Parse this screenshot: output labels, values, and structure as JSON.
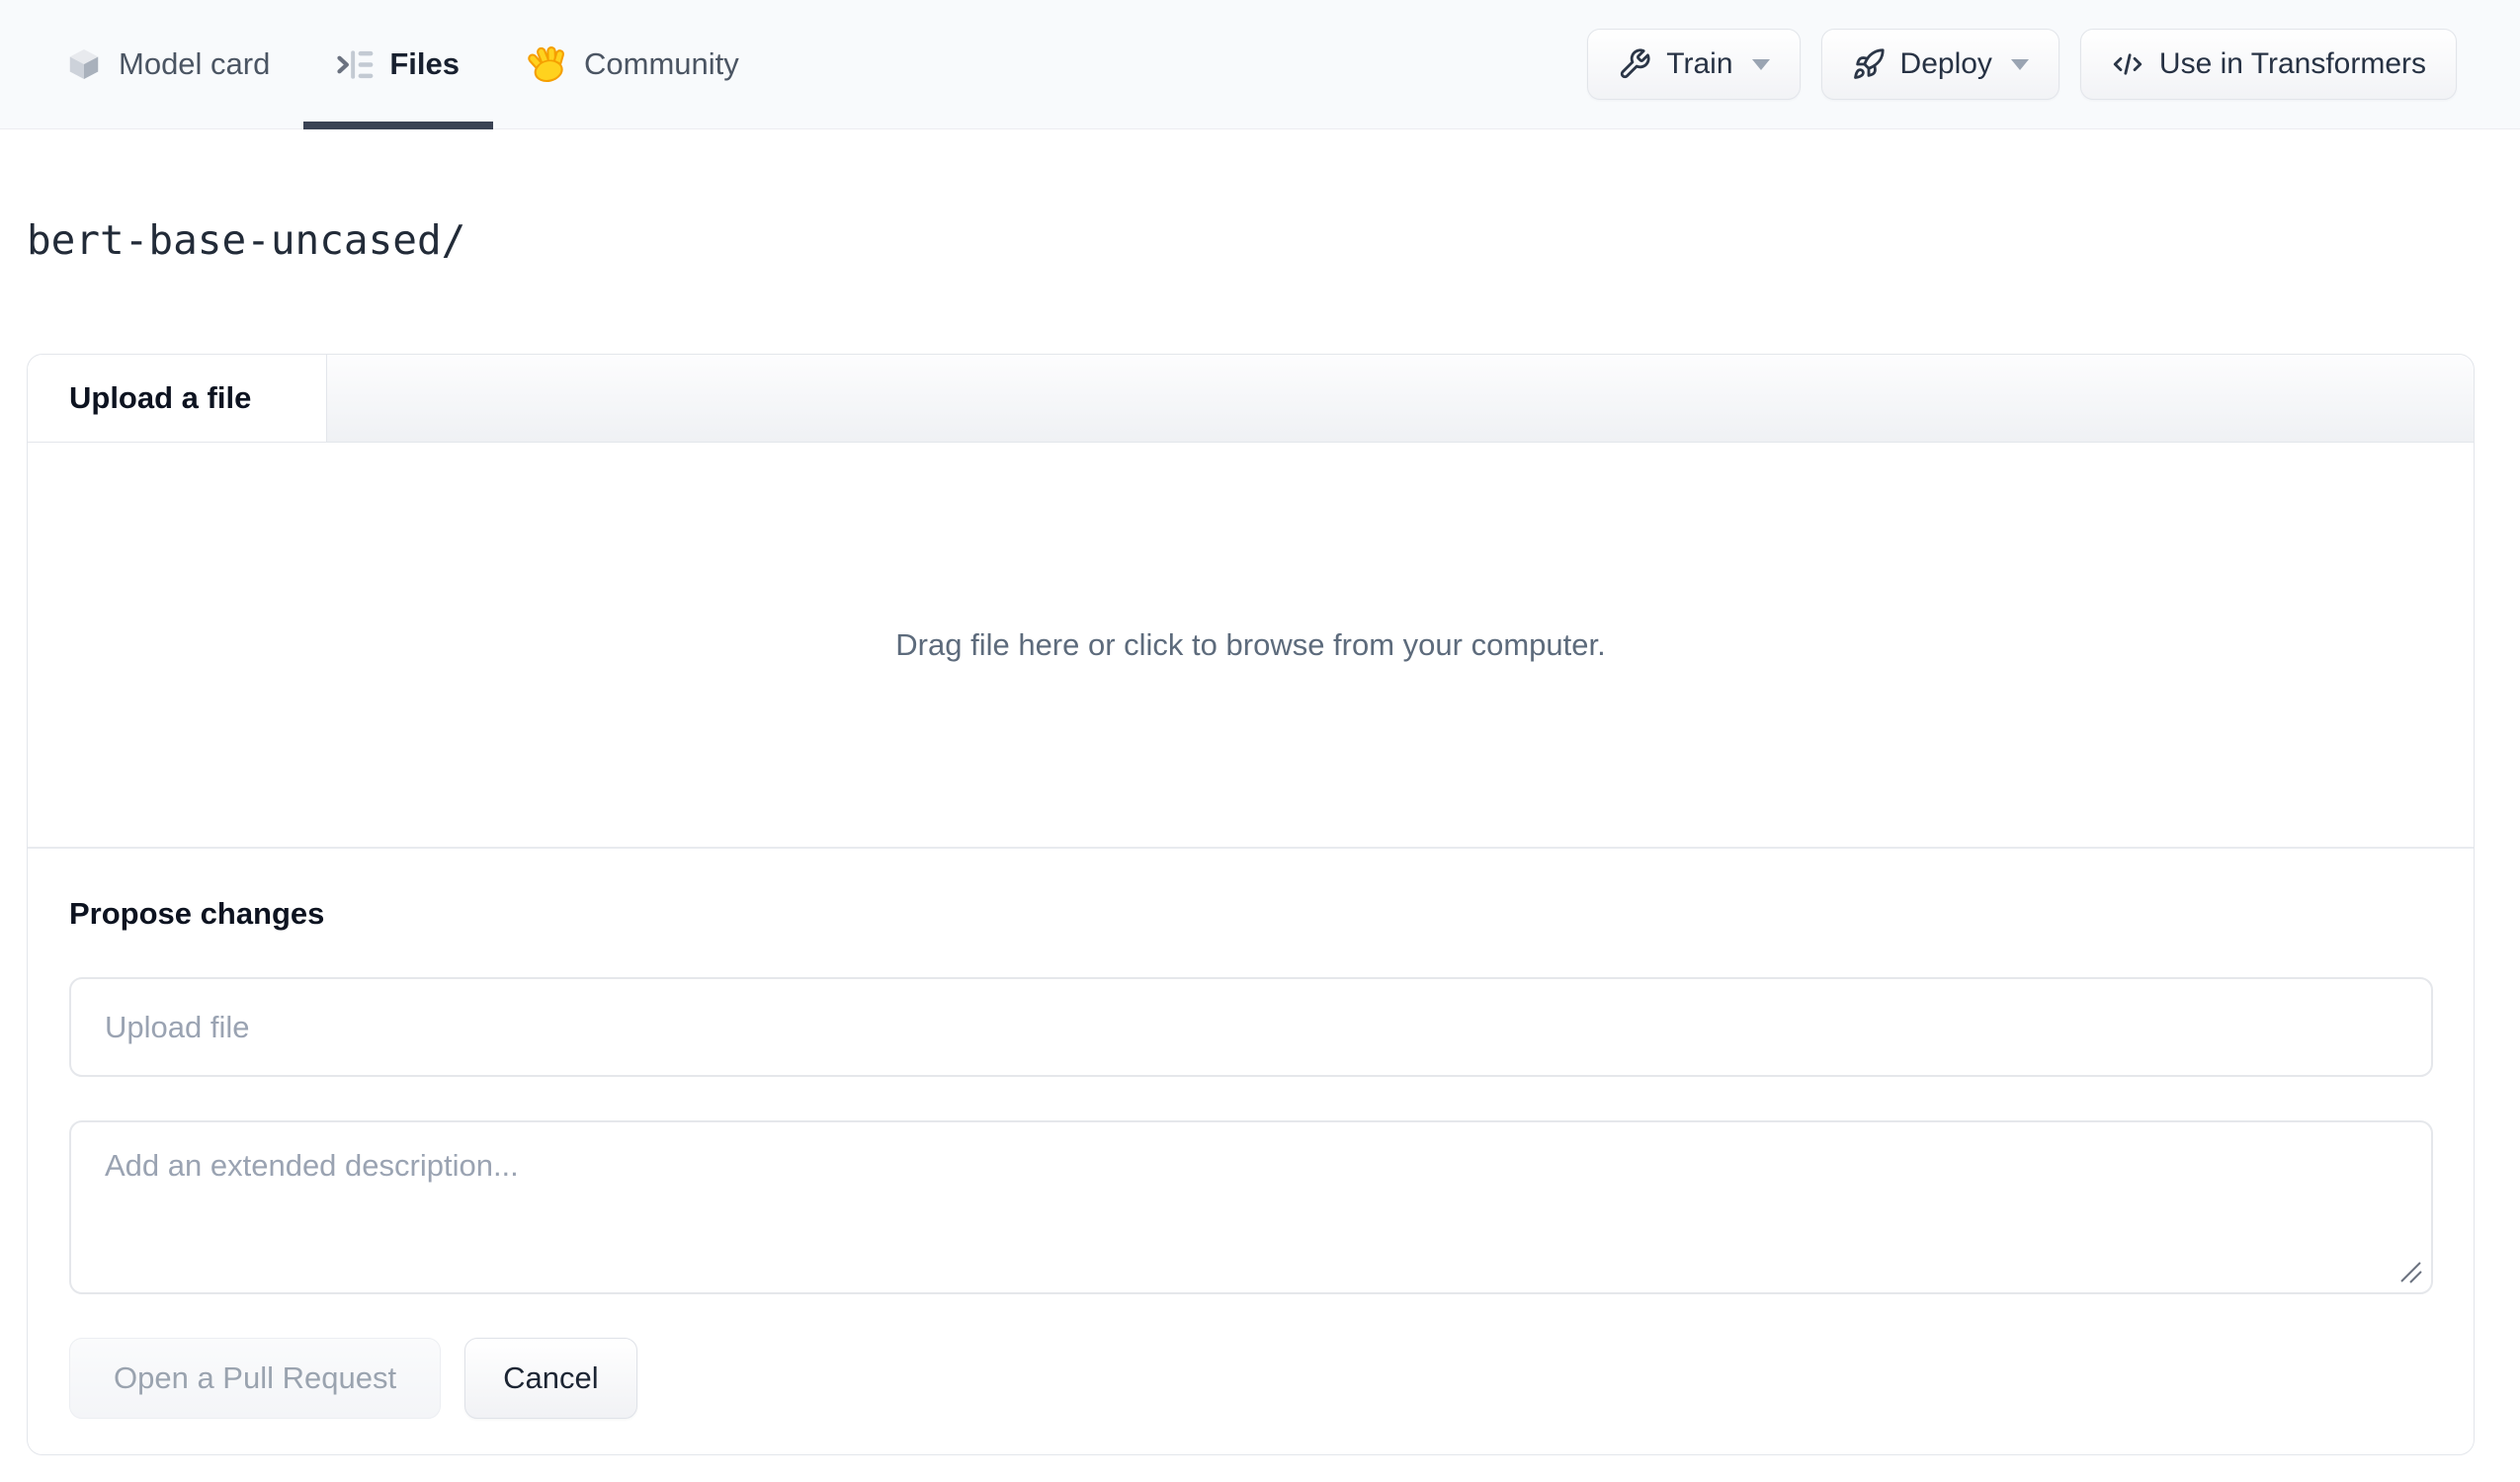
{
  "header": {
    "tabs": [
      {
        "label": "Model card",
        "icon": "cube-icon",
        "active": false
      },
      {
        "label": "Files",
        "icon": "files-list-icon",
        "active": true
      },
      {
        "label": "Community",
        "icon": "waving-hand-icon",
        "active": false
      }
    ],
    "actions": {
      "train_label": "Train",
      "deploy_label": "Deploy",
      "use_in_transformers_label": "Use in Transformers"
    }
  },
  "breadcrumb": {
    "path": "bert-base-uncased/"
  },
  "upload_card": {
    "tab_label": "Upload a file",
    "dropzone_text": "Drag file here or click to browse from your computer.",
    "propose_heading": "Propose changes",
    "file_input_placeholder": "Upload file",
    "description_placeholder": "Add an extended description...",
    "open_pr_label": "Open a Pull Request",
    "cancel_label": "Cancel"
  },
  "colors": {
    "header_bg": "#f8fafc",
    "active_tab_underline": "#3a4354",
    "border": "#e5e7eb",
    "muted_text": "#5d6b7c",
    "placeholder_text": "#9aa3b2",
    "hand_yellow": "#FFD21E",
    "hand_outline": "#F59F00"
  }
}
